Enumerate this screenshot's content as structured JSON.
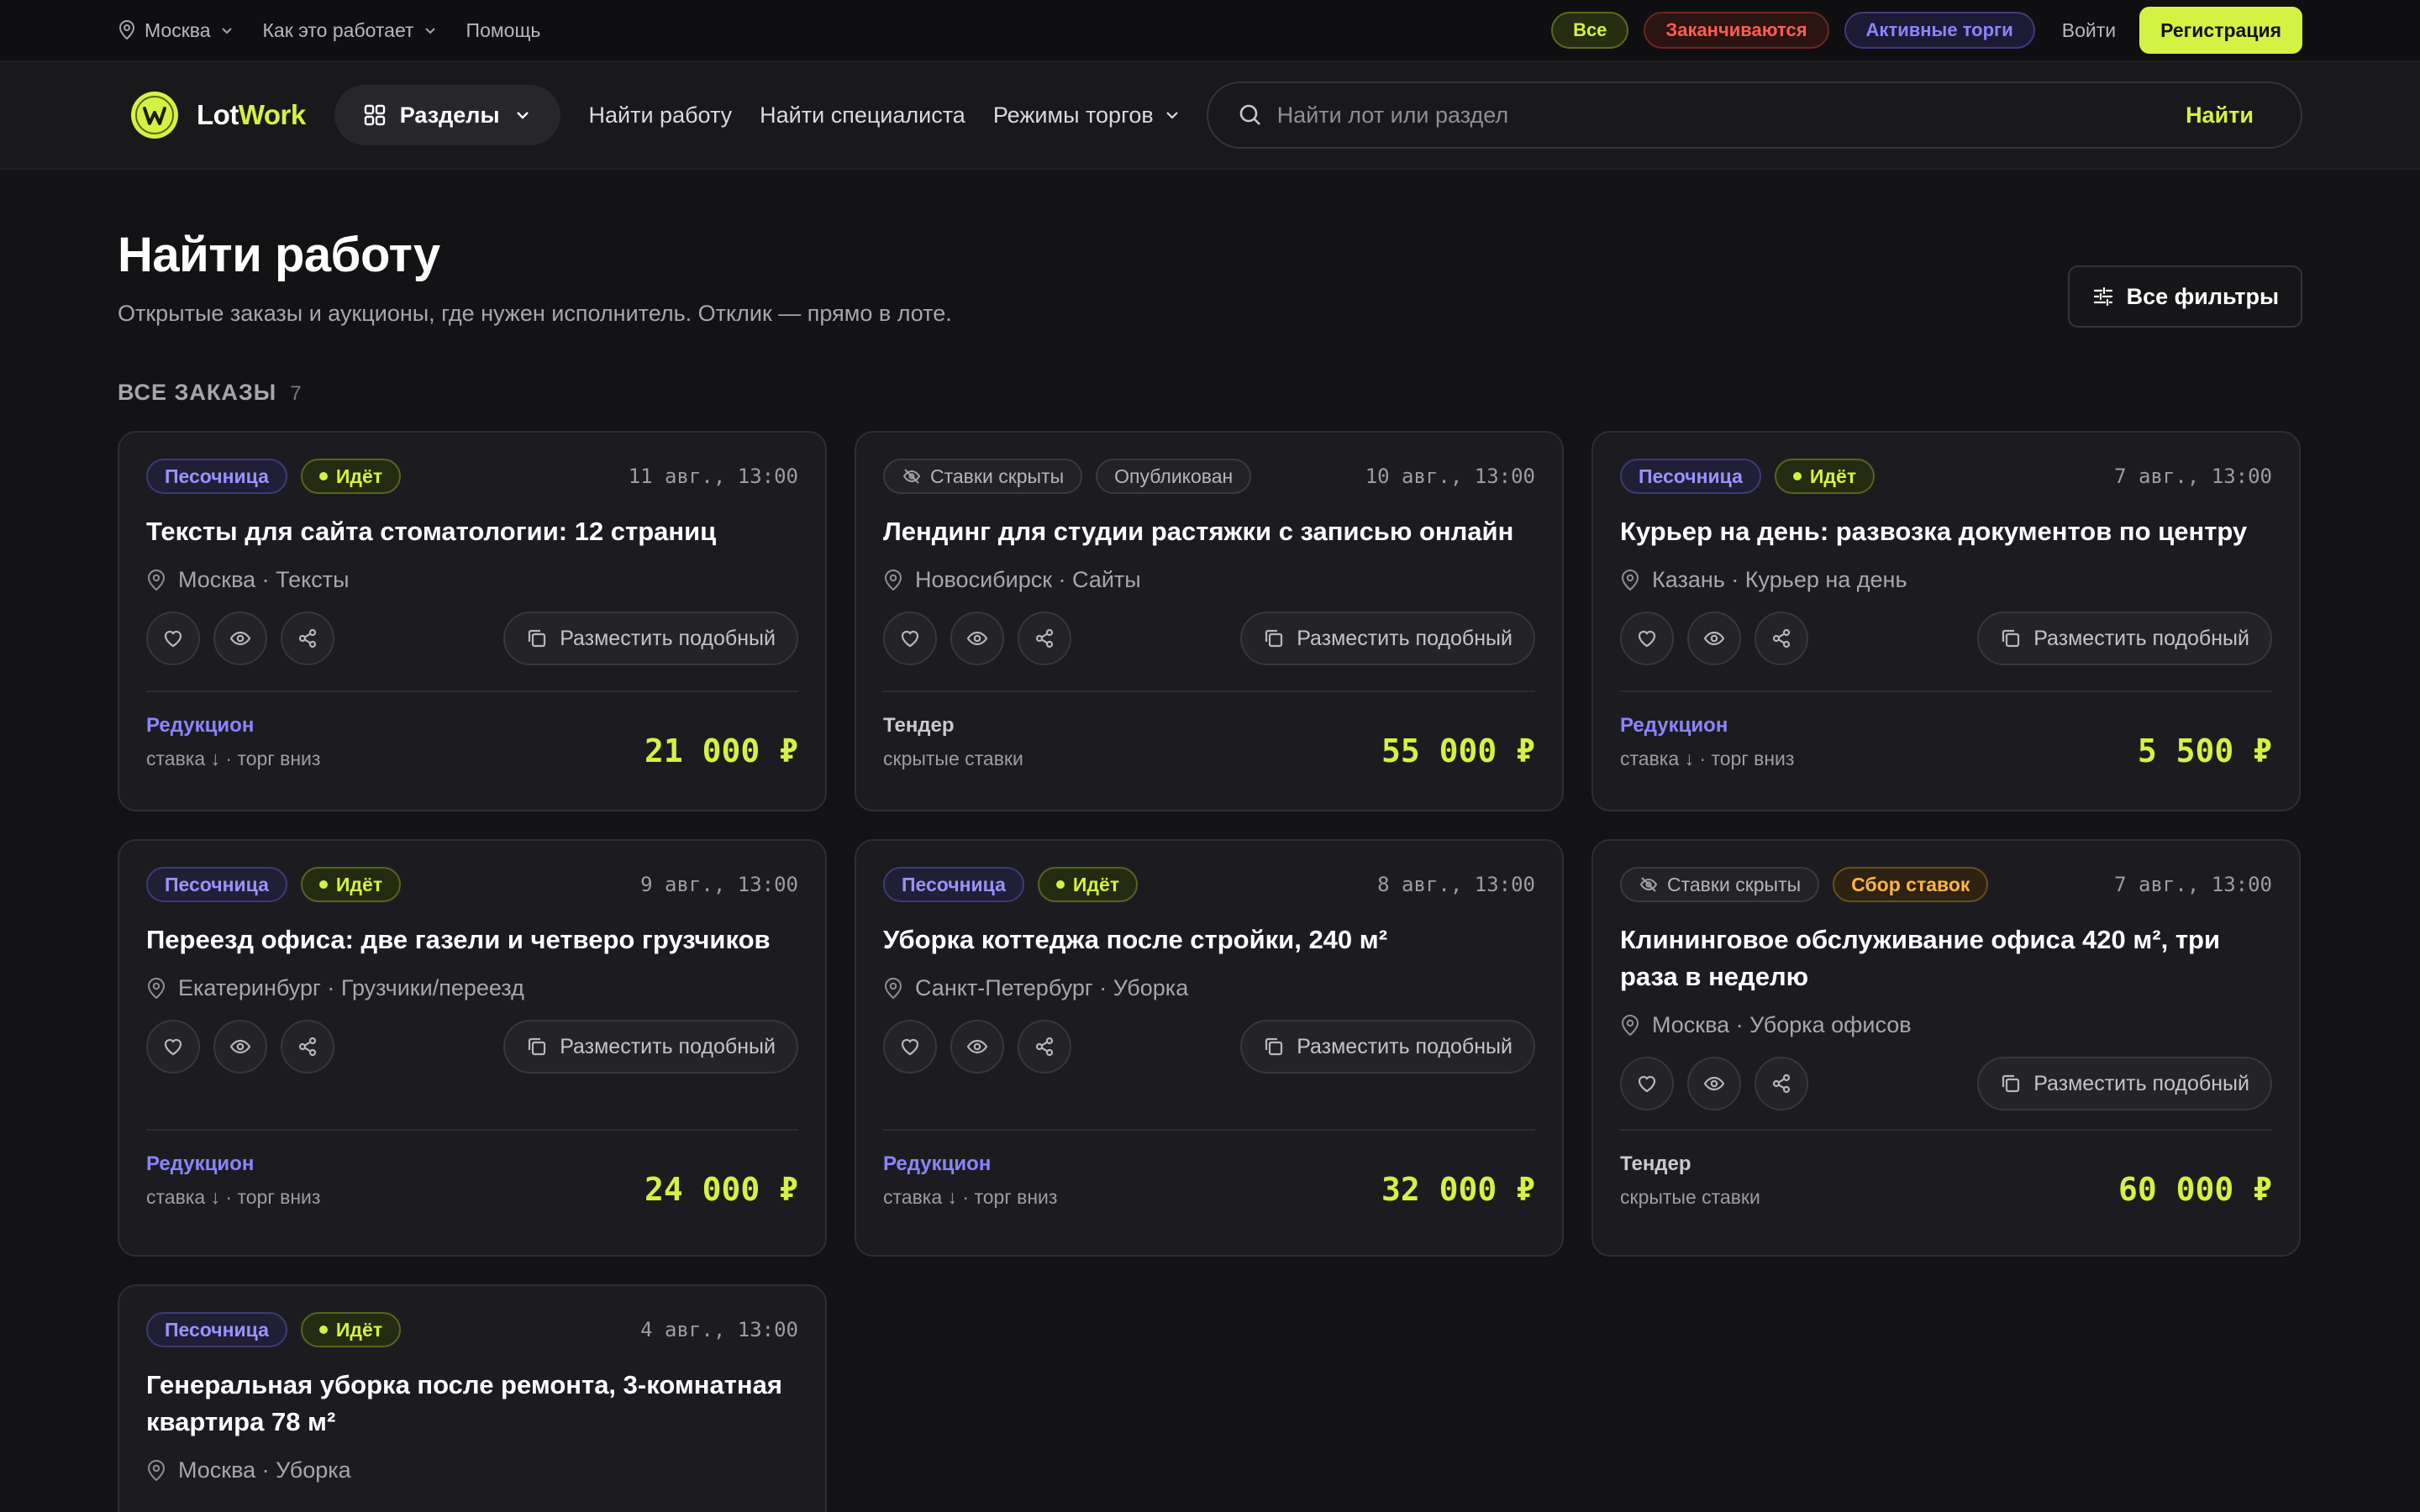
{
  "topbar": {
    "city": "Москва",
    "how_it_works": "Как это работает",
    "help": "Помощь",
    "pill_all": "Все",
    "pill_ending": "Заканчиваются",
    "pill_active": "Активные торги",
    "login": "Войти",
    "register": "Регистрация"
  },
  "header": {
    "logo_lot": "Lot",
    "logo_work": "Work",
    "sections": "Разделы",
    "nav_find_work": "Найти работу",
    "nav_find_specialist": "Найти специалиста",
    "nav_trade_modes": "Режимы торгов",
    "search_placeholder": "Найти лот или раздел",
    "search_button": "Найти"
  },
  "page": {
    "title": "Найти работу",
    "subtitle": "Открытые заказы и аукционы, где нужен исполнитель. Отклик — прямо в лоте.",
    "filters_button": "Все фильтры",
    "section_label": "ВСЕ ЗАКАЗЫ",
    "section_count": "7"
  },
  "card_common": {
    "similar_label": "Разместить подобный"
  },
  "cards": [
    {
      "tag1": "Песочница",
      "tag2": "Идёт",
      "date": "11 авг., 13:00",
      "title": "Тексты для сайта стоматологии: 12 страниц",
      "meta": "Москва · Тексты",
      "mode": "Редукцион",
      "mode_desc": "ставка ↓ · торг вниз",
      "price": "21 000 ₽"
    },
    {
      "tag1": "Ставки скрыты",
      "tag2": "Опубликован",
      "date": "10 авг., 13:00",
      "title": "Лендинг для студии растяжки с записью онлайн",
      "meta": "Новосибирск · Сайты",
      "mode": "Тендер",
      "mode_desc": "скрытые ставки",
      "price": "55 000 ₽"
    },
    {
      "tag1": "Песочница",
      "tag2": "Идёт",
      "date": "7 авг., 13:00",
      "title": "Курьер на день: развозка документов по центру",
      "meta": "Казань · Курьер на день",
      "mode": "Редукцион",
      "mode_desc": "ставка ↓ · торг вниз",
      "price": "5 500 ₽"
    },
    {
      "tag1": "Песочница",
      "tag2": "Идёт",
      "date": "9 авг., 13:00",
      "title": "Переезд офиса: две газели и четверо грузчиков",
      "meta": "Екатеринбург · Грузчики/переезд",
      "mode": "Редукцион",
      "mode_desc": "ставка ↓ · торг вниз",
      "price": "24 000 ₽"
    },
    {
      "tag1": "Песочница",
      "tag2": "Идёт",
      "date": "8 авг., 13:00",
      "title": "Уборка коттеджа после стройки, 240 м²",
      "meta": "Санкт-Петербург · Уборка",
      "mode": "Редукцион",
      "mode_desc": "ставка ↓ · торг вниз",
      "price": "32 000 ₽"
    },
    {
      "tag1": "Ставки скрыты",
      "tag2": "Сбор ставок",
      "date": "7 авг., 13:00",
      "title": "Клининговое обслуживание офиса 420 м², три раза в неделю",
      "meta": "Москва · Уборка офисов",
      "mode": "Тендер",
      "mode_desc": "скрытые ставки",
      "price": "60 000 ₽"
    },
    {
      "tag1": "Песочница",
      "tag2": "Идёт",
      "date": "4 авг., 13:00",
      "title": "Генеральная уборка после ремонта, 3-комнатная квартира 78 м²",
      "meta": "Москва · Уборка"
    }
  ],
  "colors": {
    "accent": "#d4f243",
    "background": "#131316",
    "card": "#1c1c20",
    "sandbox": "#9a93ff",
    "ending": "#ff5d4f",
    "collect": "#ffb547"
  }
}
